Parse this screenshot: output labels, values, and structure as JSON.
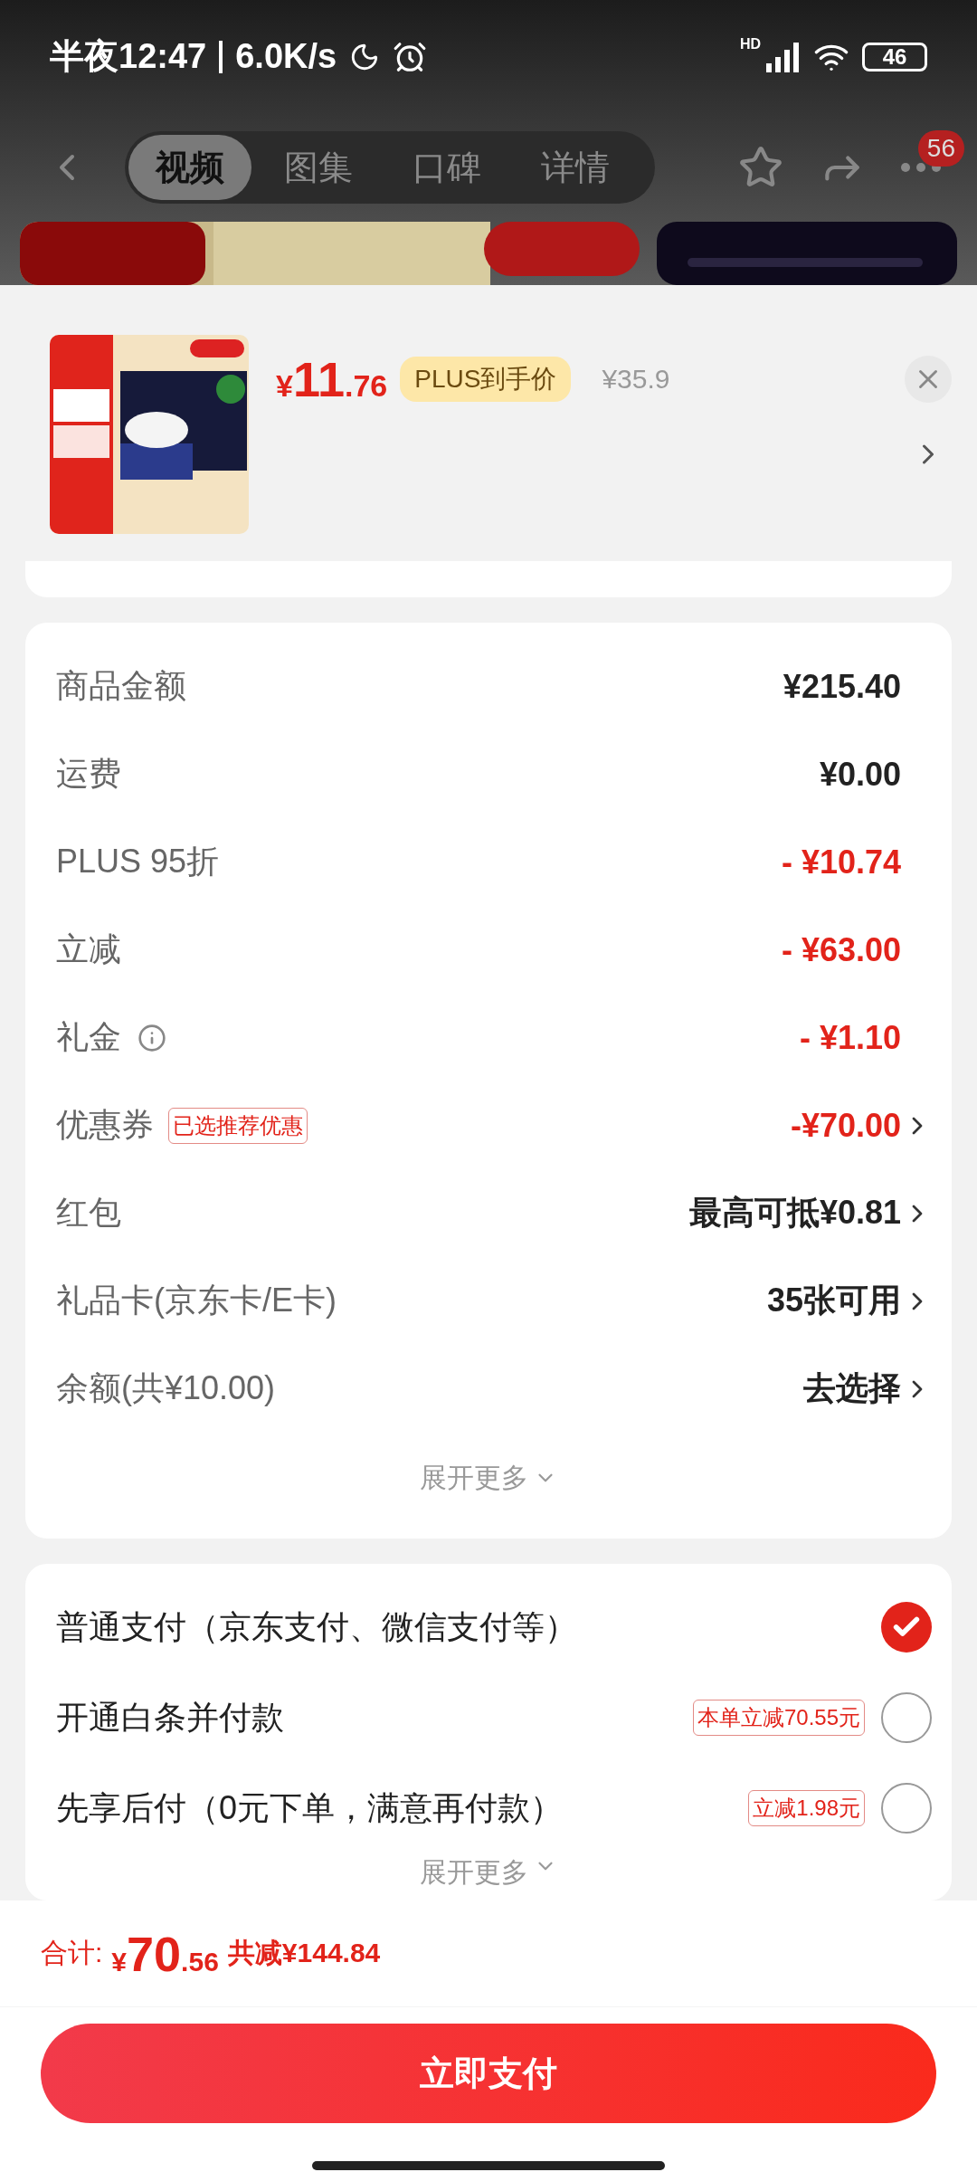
{
  "status_bar": {
    "time": "半夜12:47",
    "network_speed": "6.0K/s",
    "signal_label": "HD",
    "battery": "46"
  },
  "nav": {
    "tabs": [
      {
        "label": "视频",
        "selected": true
      },
      {
        "label": "图集",
        "selected": false
      },
      {
        "label": "口碑",
        "selected": false
      },
      {
        "label": "详情",
        "selected": false
      }
    ],
    "more_badge": "56"
  },
  "product": {
    "price": {
      "currency": "¥",
      "integer": "11",
      "decimal": ".76"
    },
    "price_badge": "PLUS到手价",
    "original_price": "¥35.9"
  },
  "fees": [
    {
      "label": "商品金额",
      "value": "¥215.40",
      "discount": false,
      "chevron": false
    },
    {
      "label": "运费",
      "value": "¥0.00",
      "discount": false,
      "chevron": false
    },
    {
      "label": "PLUS 95折",
      "value": "- ¥10.74",
      "discount": true,
      "chevron": false
    },
    {
      "label": "立减",
      "value": "- ¥63.00",
      "discount": true,
      "chevron": false
    },
    {
      "label": "礼金",
      "value": "- ¥1.10",
      "discount": true,
      "chevron": false,
      "info": true
    },
    {
      "label": "优惠券",
      "tag": "已选推荐优惠",
      "value": "-¥70.00",
      "discount": true,
      "chevron": true
    },
    {
      "label": "红包",
      "value": "最高可抵¥0.81",
      "discount": false,
      "chevron": true
    },
    {
      "label": "礼品卡(京东卡/E卡)",
      "value": "35张可用",
      "discount": false,
      "chevron": true
    },
    {
      "label": "余额(共¥10.00)",
      "value": "去选择",
      "discount": false,
      "chevron": true
    }
  ],
  "fees_expand": "展开更多",
  "payment_methods": [
    {
      "label": "普通支付（京东支付、微信支付等）",
      "selected": true
    },
    {
      "label": "开通白条并付款",
      "tag": "本单立减70.55元",
      "selected": false
    },
    {
      "label": "先享后付（0元下单，满意再付款）",
      "tag": "立减1.98元",
      "selected": false
    }
  ],
  "payment_expand": "展开更多",
  "total": {
    "label": "合计:",
    "currency": "¥",
    "integer": "70",
    "decimal": ".56",
    "savings": "共减¥144.84"
  },
  "pay_button": "立即支付"
}
